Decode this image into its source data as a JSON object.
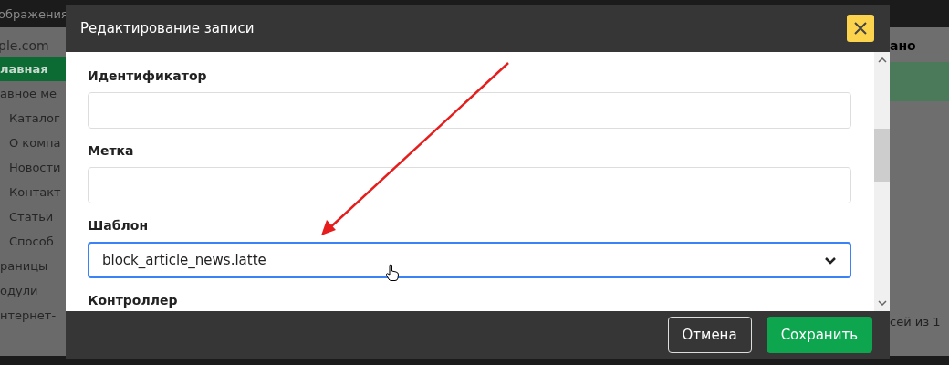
{
  "backdrop": {
    "top_bar_text": "ображения",
    "site": "ple.com",
    "sidebar": [
      {
        "label": "лавная",
        "selected": true,
        "indented": false
      },
      {
        "label": "авное ме",
        "selected": false,
        "indented": false
      },
      {
        "label": "Каталог",
        "selected": false,
        "indented": true
      },
      {
        "label": "О компа",
        "selected": false,
        "indented": true
      },
      {
        "label": "Новости",
        "selected": false,
        "indented": true
      },
      {
        "label": "Контакт",
        "selected": false,
        "indented": true
      },
      {
        "label": "Статьи",
        "selected": false,
        "indented": true
      },
      {
        "label": "Способ",
        "selected": false,
        "indented": true
      },
      {
        "label": "раницы",
        "selected": false,
        "indented": false
      },
      {
        "label": "одули",
        "selected": false,
        "indented": false
      },
      {
        "label": "нтернет-",
        "selected": false,
        "indented": false
      }
    ],
    "column_heading": "ано",
    "pager": "сей из 1"
  },
  "dialog": {
    "title": "Редактирование записи",
    "fields": [
      {
        "label": "Идентификатор",
        "kind": "text",
        "focused": false
      },
      {
        "label": "Метка",
        "kind": "text",
        "focused": false
      },
      {
        "label": "Шаблон",
        "kind": "select",
        "value": "block_article_news.latte",
        "focused": true
      },
      {
        "label": "Контроллер",
        "kind": "label_only"
      }
    ],
    "buttons": [
      {
        "label": "Отмена",
        "kind": "secondary"
      },
      {
        "label": "Сохранить",
        "kind": "primary"
      }
    ]
  }
}
